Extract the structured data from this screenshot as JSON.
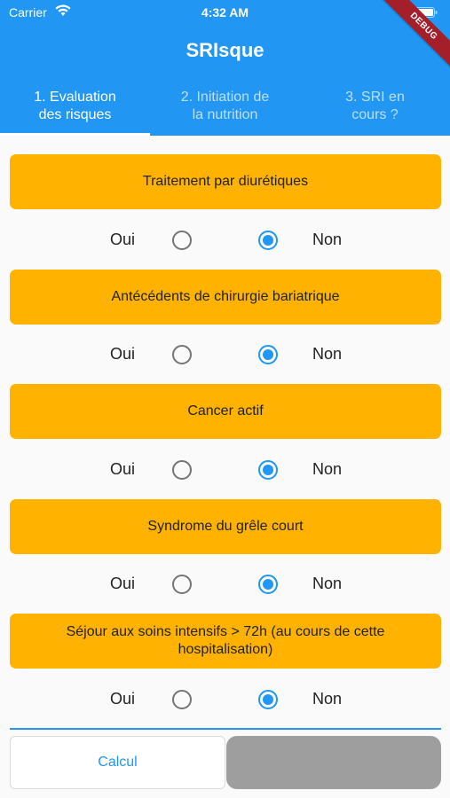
{
  "status_bar": {
    "carrier": "Carrier",
    "time": "4:32 AM"
  },
  "debug_banner": "DEBUG",
  "app": {
    "title": "SRIsque"
  },
  "tabs": [
    {
      "line1": "1. Evaluation",
      "line2": "des risques",
      "active": true
    },
    {
      "line1": "2. Initiation de",
      "line2": "la nutrition",
      "active": false
    },
    {
      "line1": "3. SRI en",
      "line2": "cours ?",
      "active": false
    }
  ],
  "questions": [
    {
      "label": "Traitement par diurétiques",
      "yes": "Oui",
      "no": "Non",
      "selected": "Non"
    },
    {
      "label": "Antécédents de chirurgie bariatrique",
      "yes": "Oui",
      "no": "Non",
      "selected": "Non"
    },
    {
      "label": "Cancer actif",
      "yes": "Oui",
      "no": "Non",
      "selected": "Non"
    },
    {
      "label": "Syndrome du grêle court",
      "yes": "Oui",
      "no": "Non",
      "selected": "Non"
    },
    {
      "label": "Séjour aux soins intensifs > 72h (au cours de cette hospitalisation)",
      "yes": "Oui",
      "no": "Non",
      "selected": "Non"
    }
  ],
  "footer": {
    "calc_label": "Calcul"
  },
  "colors": {
    "primary": "#2196f3",
    "question_bg": "#ffb300",
    "disabled_button": "#9e9e9e"
  }
}
